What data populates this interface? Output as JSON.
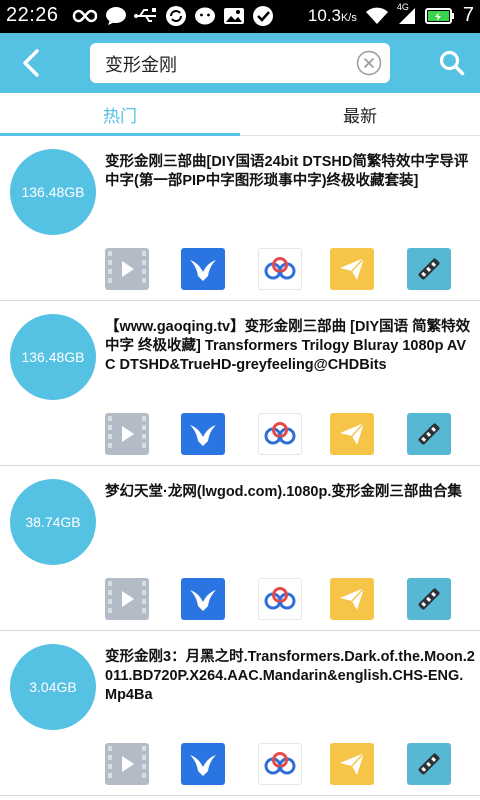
{
  "status_bar": {
    "time": "22:26",
    "network_speed": "10.3",
    "network_unit": "K/s",
    "signal_type": "4G",
    "battery_number": "7"
  },
  "header": {
    "search_value": "变形金刚"
  },
  "tabs": [
    {
      "label": "热门",
      "active": true
    },
    {
      "label": "最新",
      "active": false
    }
  ],
  "results": [
    {
      "size": "136.48GB",
      "title": "变形金刚三部曲[DIY国语24bit DTSHD简繁特效中字导评中字(第一部PIP中字图形琐事中字)终极收藏套装]"
    },
    {
      "size": "136.48GB",
      "title": "【www.gaoqing.tv】变形金刚三部曲 [DIY国语 简繁特效中字 终极收藏] Transformers Trilogy Bluray 1080p AVC DTSHD&TrueHD-greyfeeling@CHDBits"
    },
    {
      "size": "38.74GB",
      "title": "梦幻天堂·龙网(lwgod.com).1080p.变形金刚三部曲合集"
    },
    {
      "size": "3.04GB",
      "title": "变形金刚3：月黑之时.Transformers.Dark.of.the.Moon.2011.BD720P.X264.AAC.Mandarin&english.CHS-ENG.Mp4Ba"
    }
  ],
  "action_icons": [
    "play-icon",
    "xunlei-bird-icon",
    "baidu-cloud-icon",
    "paper-plane-icon",
    "magnet-link-icon"
  ],
  "colors": {
    "accent": "#55c2e4",
    "play": "#b3bcc6",
    "xunlei": "#2b75e3",
    "share": "#f6c548",
    "magnet": "#56b8d3"
  }
}
